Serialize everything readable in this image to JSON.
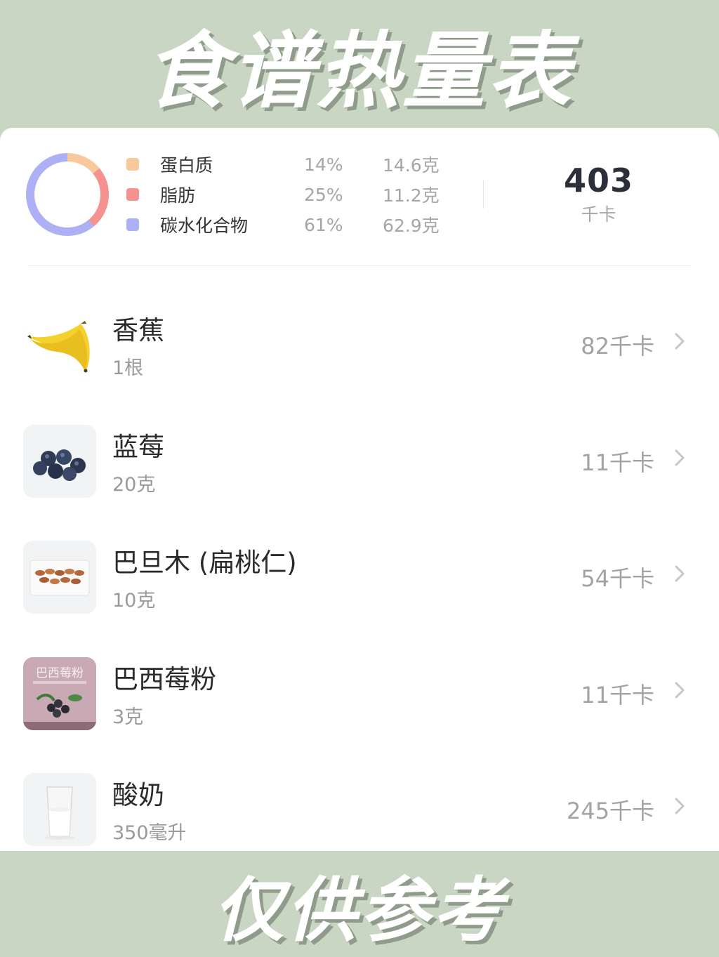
{
  "header": {
    "title": "食谱热量表"
  },
  "summary": {
    "macros": [
      {
        "name": "蛋白质",
        "percent": "14%",
        "grams": "14.6克",
        "color": "#f8c99a",
        "fraction": 0.14
      },
      {
        "name": "脂肪",
        "percent": "25%",
        "grams": "11.2克",
        "color": "#f5918e",
        "fraction": 0.25
      },
      {
        "name": "碳水化合物",
        "percent": "61%",
        "grams": "62.9克",
        "color": "#aeb0f6",
        "fraction": 0.61
      }
    ],
    "total_value": "403",
    "total_unit": "千卡"
  },
  "foods": [
    {
      "name": "香蕉",
      "amount": "1根",
      "calories": "82千卡",
      "icon": "banana-icon"
    },
    {
      "name": "蓝莓",
      "amount": "20克",
      "calories": "11千卡",
      "icon": "blueberry-icon"
    },
    {
      "name": "巴旦木 (扁桃仁)",
      "amount": "10克",
      "calories": "54千卡",
      "icon": "almond-icon"
    },
    {
      "name": "巴西莓粉",
      "amount": "3克",
      "calories": "11千卡",
      "icon": "acai-powder-icon",
      "package_text": "巴西莓粉"
    },
    {
      "name": "酸奶",
      "amount": "350毫升",
      "calories": "245千卡",
      "icon": "yogurt-icon"
    }
  ],
  "footer": {
    "text": "仅供参考"
  }
}
